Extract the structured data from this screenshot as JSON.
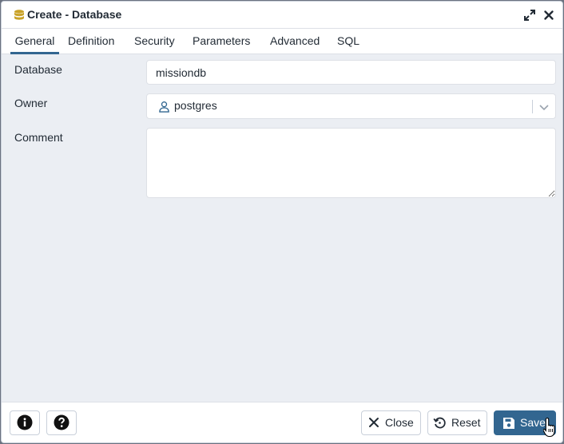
{
  "window": {
    "title": "Create - Database",
    "icon": "database-icon"
  },
  "tabs": [
    {
      "label": "General",
      "active": true
    },
    {
      "label": "Definition",
      "active": false
    },
    {
      "label": "Security",
      "active": false
    },
    {
      "label": "Parameters",
      "active": false
    },
    {
      "label": "Advanced",
      "active": false
    },
    {
      "label": "SQL",
      "active": false
    }
  ],
  "form": {
    "database": {
      "label": "Database",
      "value": "missiondb"
    },
    "owner": {
      "label": "Owner",
      "value": "postgres",
      "icon": "user-icon"
    },
    "comment": {
      "label": "Comment",
      "value": ""
    }
  },
  "footer": {
    "info_icon": "info-icon",
    "help_icon": "help-icon",
    "close_label": "Close",
    "reset_label": "Reset",
    "save_label": "Save"
  },
  "colors": {
    "accent": "#326690",
    "background": "#ebeef3",
    "border": "#dde0e6",
    "text": "#222b35"
  }
}
